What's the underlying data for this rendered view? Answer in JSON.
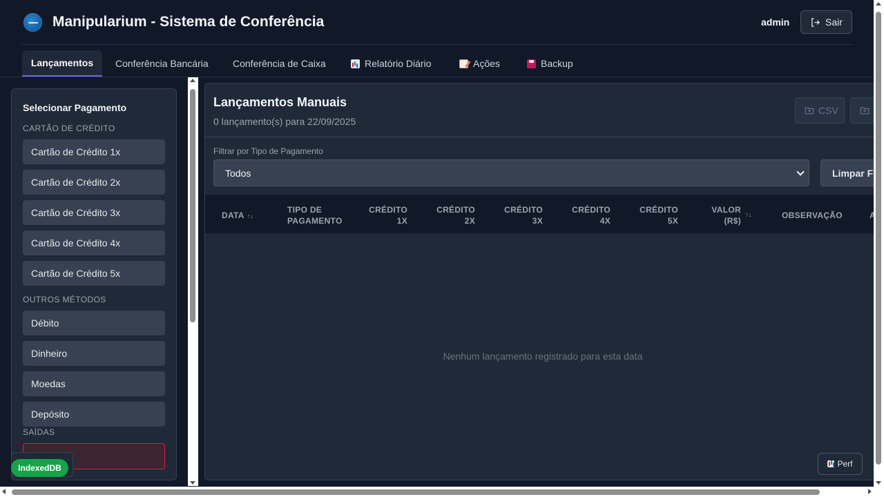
{
  "header": {
    "app_title": "Manipularium - Sistema de Conferência",
    "user": "admin",
    "logout_label": "Sair"
  },
  "tabs": [
    {
      "label": "Lançamentos",
      "active": true,
      "icon": ""
    },
    {
      "label": "Conferência Bancária",
      "icon": ""
    },
    {
      "label": "Conferência de Caixa",
      "icon": ""
    },
    {
      "label": "Relatório Diário",
      "icon": "bar-chart-icon"
    },
    {
      "label": "Ações",
      "icon": "memo-icon"
    },
    {
      "label": "Backup",
      "icon": "floppy-disk-icon"
    }
  ],
  "sidebar": {
    "title": "Selecionar Pagamento",
    "credit_group": "CARTÃO DE CRÉDITO",
    "credit_items": [
      "Cartão de Crédito 1x",
      "Cartão de Crédito 2x",
      "Cartão de Crédito 3x",
      "Cartão de Crédito 4x",
      "Cartão de Crédito 5x"
    ],
    "other_group": "OUTROS MÉTODOS",
    "other_items": [
      "Débito",
      "Dinheiro",
      "Moedas",
      "Depósito"
    ],
    "exits_group": "SAÍDAS"
  },
  "main": {
    "title": "Lançamentos Manuais",
    "subtitle": "0 lançamento(s) para 22/09/2025",
    "csv_label": "CSV",
    "filter_label": "Filtrar por Tipo de Pagamento",
    "filter_value": "Todos",
    "clear_label": "Limpar Fil",
    "columns": [
      "DATA",
      "TIPO DE PAGAMENTO",
      "CRÉDITO 1X",
      "CRÉDITO 2X",
      "CRÉDITO 3X",
      "CRÉDITO 4X",
      "CRÉDITO 5X",
      "VALOR (R$)",
      "OBSERVAÇÃO",
      "A"
    ],
    "empty_message": "Nenhum lançamento registrado para esta data"
  },
  "perf_label": "Perf",
  "storage_badge": "IndexedDB",
  "colors": {
    "accent": "#6366f1",
    "storage_badge": "#16a34a",
    "exit_border": "#e11d48",
    "background": "#111827",
    "panel": "#1f2937"
  }
}
